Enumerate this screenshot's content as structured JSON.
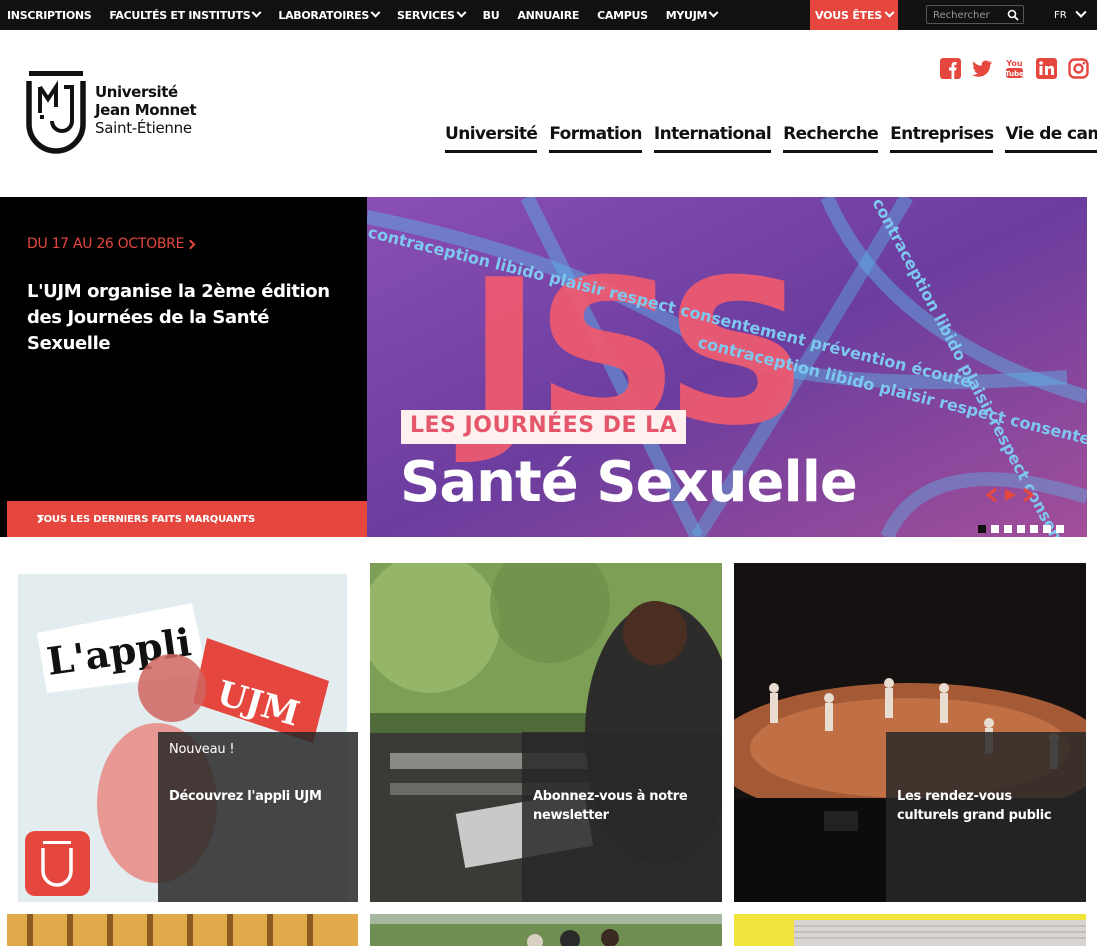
{
  "topbar": {
    "items": [
      {
        "label": "INSCRIPTIONS",
        "has_menu": false
      },
      {
        "label": "FACULTÉS ET INSTITUTS",
        "has_menu": true
      },
      {
        "label": "LABORATOIRES",
        "has_menu": true
      },
      {
        "label": "SERVICES",
        "has_menu": true
      },
      {
        "label": "BU",
        "has_menu": false
      },
      {
        "label": "ANNUAIRE",
        "has_menu": false
      },
      {
        "label": "CAMPUS",
        "has_menu": false
      },
      {
        "label": "MYUJM",
        "has_menu": true
      }
    ],
    "vous_etes": "VOUS ÊTES",
    "search_placeholder": "Rechercher",
    "lang": "FR"
  },
  "logo": {
    "line1": "Université",
    "line2": "Jean Monnet",
    "line3": "Saint-Étienne"
  },
  "social": [
    "facebook-icon",
    "twitter-icon",
    "youtube-icon",
    "linkedin-icon",
    "instagram-icon"
  ],
  "mainnav": [
    "Université",
    "Formation",
    "International",
    "Recherche",
    "Entreprises",
    "Vie de campus"
  ],
  "hero": {
    "date": "DU 17 AU 26 OCTOBRE",
    "title": "L'UJM organise la 2ème édition des Journées de la Santé Sexuelle",
    "button": "TOUS LES DERNIERS FAITS MARQUANTS",
    "image_kicker": "LES JOURNÉES DE LA",
    "image_headline": "Santé Sexuelle",
    "image_letters": "JSS",
    "image_words": "contraception libido plaisir respect consentement prévention écoute",
    "active_slide": 1,
    "slides_count": 7
  },
  "cards": [
    {
      "kicker": "Nouveau !",
      "title": "Découvrez l'appli UJM",
      "image_text_1": "L'appli",
      "image_text_2": "UJM"
    },
    {
      "kicker": "",
      "title": "Abonnez-vous à notre newsletter"
    },
    {
      "kicker": "",
      "title": "Les rendez-vous culturels grand public"
    }
  ],
  "colors": {
    "accent": "#e5473f",
    "dark": "#111111",
    "hero_purple": "#6a3fa0",
    "hero_pink": "#ef5a6f"
  }
}
